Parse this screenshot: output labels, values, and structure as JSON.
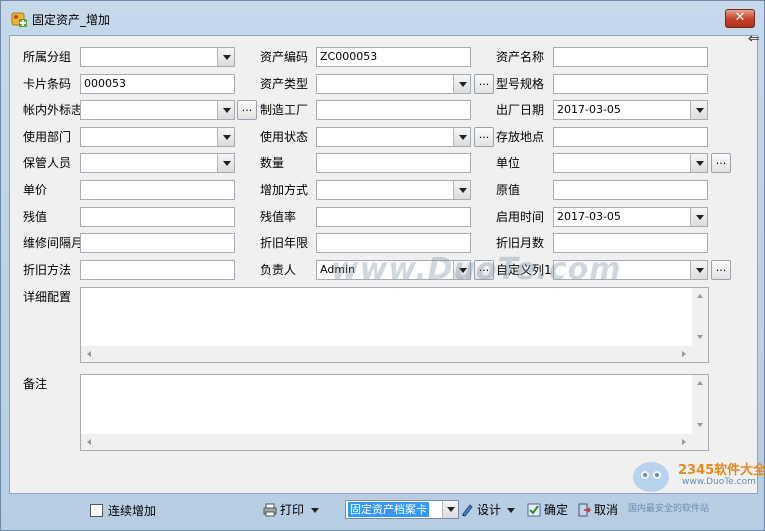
{
  "window": {
    "title": "固定资产_增加",
    "close_label": "✕"
  },
  "form": {
    "row1": {
      "group_label": "所属分组",
      "group_value": "",
      "code_label": "资产编码",
      "code_value": "ZC000053",
      "name_label": "资产名称",
      "name_value": ""
    },
    "row2": {
      "card_label": "卡片条码",
      "card_value": "000053",
      "type_label": "资产类型",
      "type_value": "",
      "model_label": "型号规格",
      "model_value": ""
    },
    "row3": {
      "inout_label": "帐内外标志",
      "inout_value": "",
      "maker_label": "制造工厂",
      "maker_value": "",
      "factory_date_label": "出厂日期",
      "factory_date_value": "2017-03-05"
    },
    "row4": {
      "dept_label": "使用部门",
      "dept_value": "",
      "status_label": "使用状态",
      "status_value": "",
      "place_label": "存放地点",
      "place_value": ""
    },
    "row5": {
      "keeper_label": "保管人员",
      "keeper_value": "",
      "qty_label": "数量",
      "qty_value": "",
      "unit_label": "单位",
      "unit_value": ""
    },
    "row6": {
      "price_label": "单价",
      "price_value": "",
      "method_label": "增加方式",
      "method_value": "",
      "orig_label": "原值",
      "orig_value": ""
    },
    "row7": {
      "residual_label": "残值",
      "residual_value": "",
      "residual_rate_label": "残值率",
      "residual_rate_value": "",
      "start_date_label": "启用时间",
      "start_date_value": "2017-03-05"
    },
    "row8": {
      "maint_label": "维修间隔月",
      "maint_value": "",
      "dep_years_label": "折旧年限",
      "dep_years_value": "",
      "dep_months_label": "折旧月数",
      "dep_months_value": ""
    },
    "row9": {
      "dep_method_label": "折旧方法",
      "dep_method_value": "",
      "owner_label": "负责人",
      "owner_value": "Admin",
      "custom_label": "自定义列1",
      "custom_value": ""
    },
    "detail_label": "详细配置",
    "remark_label": "备注",
    "ellipsis": "..."
  },
  "bottom": {
    "continuous_add_label": "连续增加",
    "print_label": "打印",
    "template_value": "固定资产档案卡",
    "design_label": "设计",
    "ok_label": "确定",
    "cancel_label": "取消"
  },
  "watermark": {
    "site": "www.DuoTe.com",
    "logo_name": "2345软件大全",
    "logo_url": "www.DuoTe.com",
    "logo_slogan": "国内最安全的软件站"
  }
}
